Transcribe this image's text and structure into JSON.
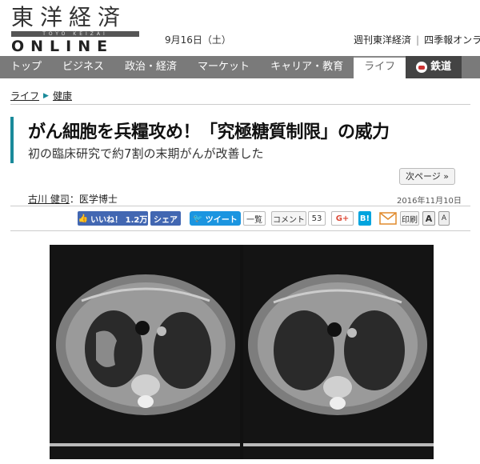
{
  "header": {
    "logo_top": "東洋経済",
    "logo_bar": "TOYO KEIZAI",
    "logo_bottom": "ONLINE",
    "date": "9月16日（土）",
    "pub_link_1": "週刊東洋経済",
    "pub_sep": "|",
    "pub_link_2": "四季報オンラ"
  },
  "nav": {
    "items": [
      {
        "label": "トップ"
      },
      {
        "label": "ビジネス"
      },
      {
        "label": "政治・経済"
      },
      {
        "label": "マーケット"
      },
      {
        "label": "キャリア・教育"
      },
      {
        "label": "ライフ"
      },
      {
        "label": "鉄道"
      }
    ]
  },
  "breadcrumb": {
    "level1": "ライフ",
    "level2": "健康"
  },
  "article": {
    "title": "がん細胞を兵糧攻め！「究極糖質制限」の威力",
    "subtitle": "初の臨床研究で約7割の末期がんが改善した",
    "next_page": "次ページ »",
    "author": "古川 健司",
    "author_title": "：医学博士",
    "pubdate": "2016年11月10日"
  },
  "share": {
    "fb_like": "いいね！ 1.2万",
    "fb_share": "シェア",
    "tweet": "ツイート",
    "ichiran": "一覧",
    "comment": "コメント",
    "comment_count": "53",
    "gplus": "G+",
    "hatena": "B!",
    "print": "印刷",
    "font_large": "A",
    "font_small": "A"
  },
  "colors": {
    "accent": "#1a8a9a",
    "nav_bg": "#7a7a7a",
    "facebook": "#4267b2",
    "twitter": "#1b95e0",
    "hatena": "#00a4de",
    "gplus": "#dd4b39"
  }
}
